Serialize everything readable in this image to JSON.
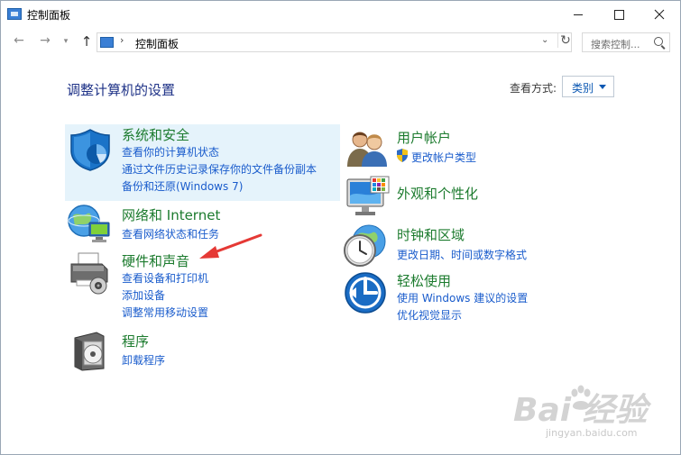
{
  "window": {
    "title": "控制面板"
  },
  "navigation": {
    "address_text": "控制面板",
    "search_placeholder": "搜索控制..."
  },
  "main": {
    "heading": "调整计算机的设置",
    "view_by_label": "查看方式:",
    "view_by_value": "类别"
  },
  "categories": [
    {
      "title": "系统和安全",
      "links": [
        "查看你的计算机状态",
        "通过文件历史记录保存你的文件备份副本",
        "备份和还原(Windows 7)"
      ]
    },
    {
      "title": "网络和 Internet",
      "links": [
        "查看网络状态和任务"
      ]
    },
    {
      "title": "硬件和声音",
      "links": [
        "查看设备和打印机",
        "添加设备",
        "调整常用移动设置"
      ]
    },
    {
      "title": "程序",
      "links": [
        "卸载程序"
      ]
    },
    {
      "title": "用户帐户",
      "links": [
        "更改帐户类型"
      ]
    },
    {
      "title": "外观和个性化",
      "links": []
    },
    {
      "title": "时钟和区域",
      "links": [
        "更改日期、时间或数字格式"
      ]
    },
    {
      "title": "轻松使用",
      "links": [
        "使用 Windows 建议的设置",
        "优化视觉显示"
      ]
    }
  ],
  "watermark": {
    "brand": "Bai  经验",
    "url": "jingyan.baidu.com"
  },
  "colors": {
    "title_green": "#1c7b2e",
    "link_blue": "#1a5ccc",
    "heading_blue": "#1e3287",
    "highlight": "#e5f3fb",
    "arrow_red": "#e53935"
  }
}
